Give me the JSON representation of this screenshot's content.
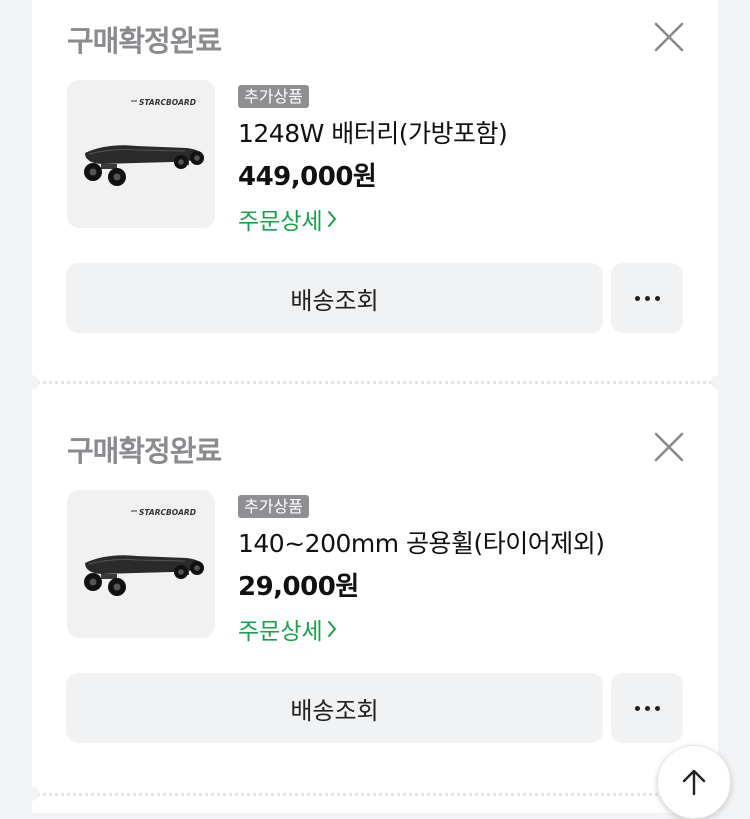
{
  "orders": [
    {
      "status": "구매확정완료",
      "tag": "추가상품",
      "product_name": "1248W 배터리(가방포함)",
      "price": "449,000원",
      "detail_link": "주문상세",
      "track_button": "배송조회",
      "brand_logo": "STARCBOARD"
    },
    {
      "status": "구매확정완료",
      "tag": "추가상품",
      "product_name": "140~200mm 공용휠(타이어제외)",
      "price": "29,000원",
      "detail_link": "주문상세",
      "track_button": "배송조회",
      "brand_logo": "STARCBOARD"
    }
  ],
  "icons": {
    "close": "close-icon",
    "more": "more-horizontal-icon",
    "detail_arrow": "chevron-right-icon",
    "scroll_top": "arrow-up-icon"
  },
  "colors": {
    "accent_green": "#16a34a",
    "tag_gray": "#8f8f93",
    "status_gray": "#8a8a8f"
  }
}
